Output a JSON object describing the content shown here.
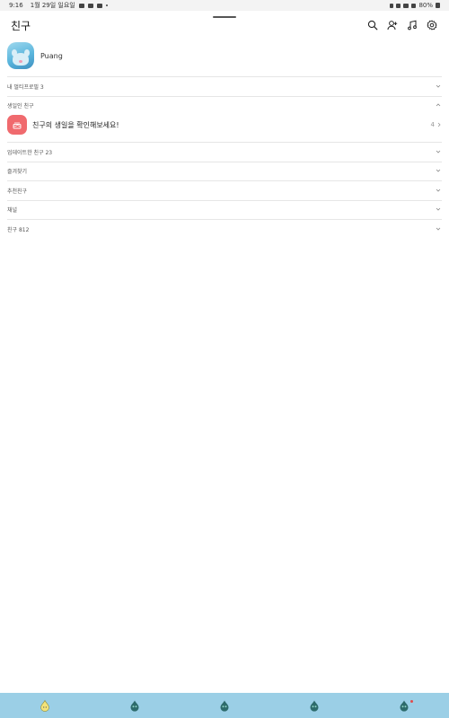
{
  "status_bar": {
    "time": "9:16",
    "date": "1월 29일 일요일",
    "battery": "80%"
  },
  "header": {
    "title": "친구"
  },
  "profile": {
    "name": "Puang"
  },
  "sections": {
    "multi_profile": "내 멀티프로필 3",
    "birthday": "생일인 친구",
    "updated_friends": "업데이트한 친구 23",
    "favorites": "즐겨찾기",
    "recommended": "추천친구",
    "channel": "채널",
    "friends": "친구 812"
  },
  "birthday_card": {
    "text": "친구의 생일을 확인해보세요!",
    "count": "4"
  },
  "colors": {
    "accent_nav": "#9bcfe6",
    "birthday_icon_bg": "#f06a6e",
    "nav_selected": "#f3e37a",
    "nav_icon": "#2d6b6b"
  },
  "bottom_nav": {
    "items": [
      "friends-tab-icon",
      "chat-tab-icon",
      "openchat-tab-icon",
      "shopping-tab-icon",
      "more-tab-icon"
    ]
  }
}
